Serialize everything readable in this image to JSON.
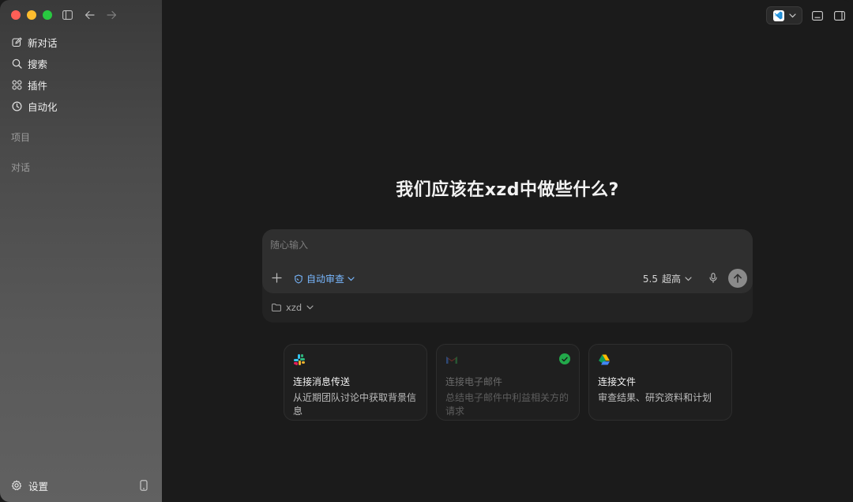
{
  "sidebar": {
    "nav": [
      {
        "label": "新对话",
        "icon": "edit-icon"
      },
      {
        "label": "搜索",
        "icon": "search-icon"
      },
      {
        "label": "插件",
        "icon": "grid-icon"
      },
      {
        "label": "自动化",
        "icon": "clock-icon"
      }
    ],
    "sections": {
      "projects": "项目",
      "conversations": "对话"
    },
    "settings_label": "设置"
  },
  "main": {
    "headline": "我们应该在xzd中做些什么?",
    "composer": {
      "placeholder": "随心输入",
      "review_label": "自动审查",
      "model_version": "5.5",
      "model_level": "超高"
    },
    "folder": "xzd",
    "cards": [
      {
        "title": "连接消息传送",
        "desc": "从近期团队讨论中获取背景信息",
        "logo": "slack-icon",
        "connected": false,
        "dim": false
      },
      {
        "title": "连接电子邮件",
        "desc": "总结电子邮件中利益相关方的请求",
        "logo": "gmail-icon",
        "connected": true,
        "dim": true
      },
      {
        "title": "连接文件",
        "desc": "审查结果、研究资料和计划",
        "logo": "drive-icon",
        "connected": false,
        "dim": false
      }
    ]
  },
  "colors": {
    "accent": "#79b8ff",
    "connected": "#22a84a",
    "close": "#ff5f57",
    "minimize": "#febc2e",
    "maximize": "#28c840"
  }
}
